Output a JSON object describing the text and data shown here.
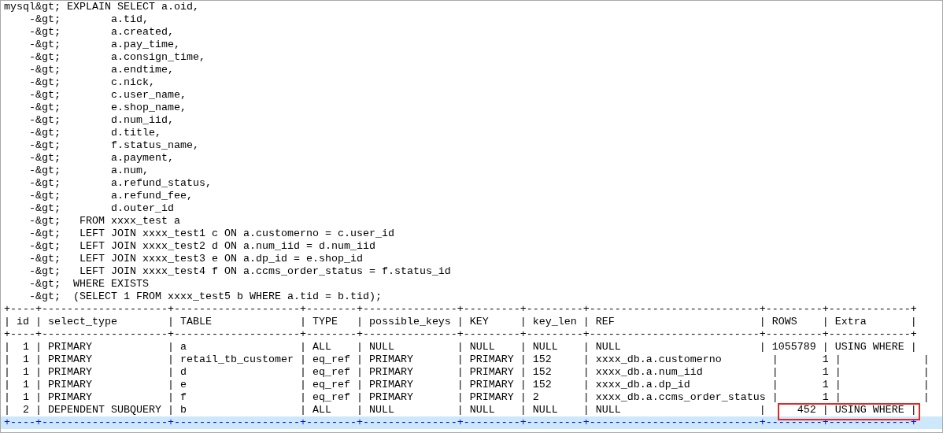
{
  "console": {
    "lines": [
      {
        "text": "mysql&gt; EXPLAIN SELECT a.oid,",
        "selected": false,
        "annotated": false
      },
      {
        "text": "    -&gt;        a.tid,",
        "selected": false,
        "annotated": false
      },
      {
        "text": "    -&gt;        a.created,",
        "selected": false,
        "annotated": false
      },
      {
        "text": "    -&gt;        a.pay_time,",
        "selected": false,
        "annotated": false
      },
      {
        "text": "    -&gt;        a.consign_time,",
        "selected": false,
        "annotated": false
      },
      {
        "text": "    -&gt;        a.endtime,",
        "selected": false,
        "annotated": false
      },
      {
        "text": "    -&gt;        c.nick,",
        "selected": false,
        "annotated": false
      },
      {
        "text": "    -&gt;        c.user_name,",
        "selected": false,
        "annotated": false
      },
      {
        "text": "    -&gt;        e.shop_name,",
        "selected": false,
        "annotated": false
      },
      {
        "text": "    -&gt;        d.num_iid,",
        "selected": false,
        "annotated": false
      },
      {
        "text": "    -&gt;        d.title,",
        "selected": false,
        "annotated": false
      },
      {
        "text": "    -&gt;        f.status_name,",
        "selected": false,
        "annotated": false
      },
      {
        "text": "    -&gt;        a.payment,",
        "selected": false,
        "annotated": false
      },
      {
        "text": "    -&gt;        a.num,",
        "selected": false,
        "annotated": false
      },
      {
        "text": "    -&gt;        a.refund_status,",
        "selected": false,
        "annotated": false
      },
      {
        "text": "    -&gt;        a.refund_fee,",
        "selected": false,
        "annotated": false
      },
      {
        "text": "    -&gt;        d.outer_id",
        "selected": false,
        "annotated": false
      },
      {
        "text": "    -&gt;   FROM xxxx_test a",
        "selected": false,
        "annotated": false
      },
      {
        "text": "    -&gt;   LEFT JOIN xxxx_test1 c ON a.customerno = c.user_id",
        "selected": false,
        "annotated": false
      },
      {
        "text": "    -&gt;   LEFT JOIN xxxx_test2 d ON a.num_iid = d.num_iid",
        "selected": false,
        "annotated": false
      },
      {
        "text": "    -&gt;   LEFT JOIN xxxx_test3 e ON a.dp_id = e.shop_id",
        "selected": false,
        "annotated": false
      },
      {
        "text": "    -&gt;   LEFT JOIN xxxx_test4 f ON a.ccms_order_status = f.status_id",
        "selected": false,
        "annotated": false
      },
      {
        "text": "    -&gt;  WHERE EXISTS",
        "selected": false,
        "annotated": false
      },
      {
        "text": "    -&gt;  (SELECT 1 FROM xxxx_test5 b WHERE a.tid = b.tid);",
        "selected": false,
        "annotated": false
      },
      {
        "text": "+----+--------------------+--------------------+--------+---------------+---------+---------+---------------------------+---------+-------------+",
        "selected": false,
        "annotated": false
      },
      {
        "text": "| id | select_type        | TABLE              | TYPE   | possible_keys | KEY     | key_len | REF                       | ROWS    | Extra       |",
        "selected": false,
        "annotated": false
      },
      {
        "text": "+----+--------------------+--------------------+--------+---------------+---------+---------+---------------------------+---------+-------------+",
        "selected": false,
        "annotated": false
      },
      {
        "text": "|  1 | PRIMARY            | a                  | ALL    | NULL          | NULL    | NULL    | NULL                      | 1055789 | USING WHERE |",
        "selected": false,
        "annotated": false
      },
      {
        "text": "|  1 | PRIMARY            | retail_tb_customer | eq_ref | PRIMARY       | PRIMARY | 152     | xxxx_db.a.customerno        |       1 |             |",
        "selected": false,
        "annotated": false
      },
      {
        "text": "|  1 | PRIMARY            | d                  | eq_ref | PRIMARY       | PRIMARY | 152     | xxxx_db.a.num_iid           |       1 |             |",
        "selected": false,
        "annotated": false
      },
      {
        "text": "|  1 | PRIMARY            | e                  | eq_ref | PRIMARY       | PRIMARY | 152     | xxxx_db.a.dp_id             |       1 |             |",
        "selected": false,
        "annotated": false
      },
      {
        "text": "|  1 | PRIMARY            | f                  | eq_ref | PRIMARY       | PRIMARY | 2       | xxxx_db.a.ccms_order_status |       1 |             |",
        "selected": false,
        "annotated": false
      },
      {
        "text": "|  2 | DEPENDENT SUBQUERY | b                  | ALL    | NULL          | NULL    | NULL    | NULL                      |     452 | USING WHERE |",
        "selected": false,
        "annotated": true
      },
      {
        "text": "+----+--------------------+--------------------+--------+---------------+---------+---------+---------------------------+---------+-------------+",
        "selected": true,
        "annotated": false
      }
    ]
  }
}
